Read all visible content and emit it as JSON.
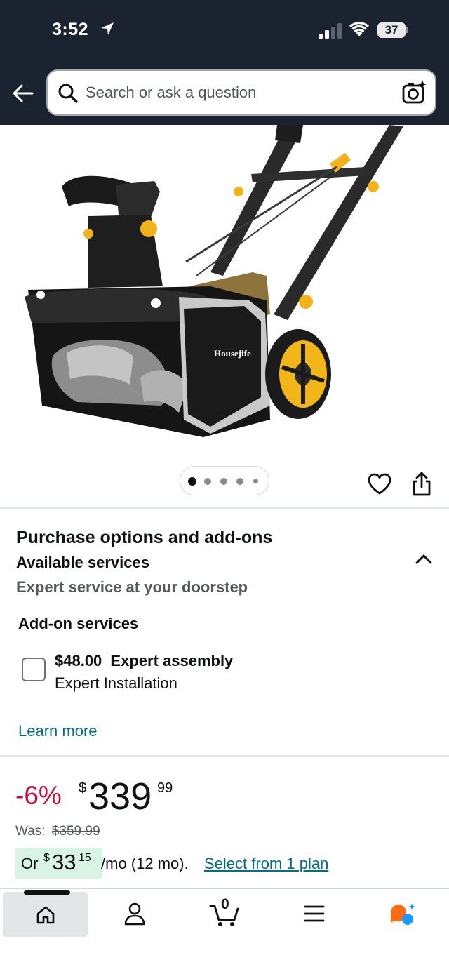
{
  "status_bar": {
    "time": "3:52",
    "battery": "37"
  },
  "search": {
    "placeholder": "Search or ask a question"
  },
  "product": {
    "brand": "Housejife",
    "image_count": 5,
    "active_image": 1
  },
  "purchase_options": {
    "title": "Purchase options and add-ons",
    "subtitle": "Available services",
    "description": "Expert service at your doorstep",
    "addon_section_title": "Add-on services",
    "addon": {
      "price": "$48.00",
      "name": "Expert assembly",
      "sub": "Expert Installation",
      "checked": false
    },
    "learn_more": "Learn more"
  },
  "price": {
    "discount": "-6%",
    "symbol": "$",
    "whole": "339",
    "fraction": "99",
    "was_label": "Was:",
    "was_price": "$359.99"
  },
  "monthly": {
    "or": "Or",
    "symbol": "$",
    "whole": "33",
    "fraction": "15",
    "terms": "/mo (12 mo).",
    "link": "Select from 1 plan"
  },
  "cart": {
    "count": "0"
  },
  "colors": {
    "header_bg": "#1b2330",
    "link": "#007185",
    "discount": "#cc0c39",
    "monthly_badge": "#d9f3e5",
    "accent_orange": "#ff6a13",
    "accent_blue": "#1a98ff"
  },
  "icons": {
    "nav": [
      "home-icon",
      "account-icon",
      "cart-icon",
      "menu-icon",
      "rufus-icon"
    ],
    "header": [
      "back-arrow-icon",
      "search-icon",
      "camera-icon"
    ],
    "product": [
      "heart-icon",
      "share-icon"
    ]
  }
}
